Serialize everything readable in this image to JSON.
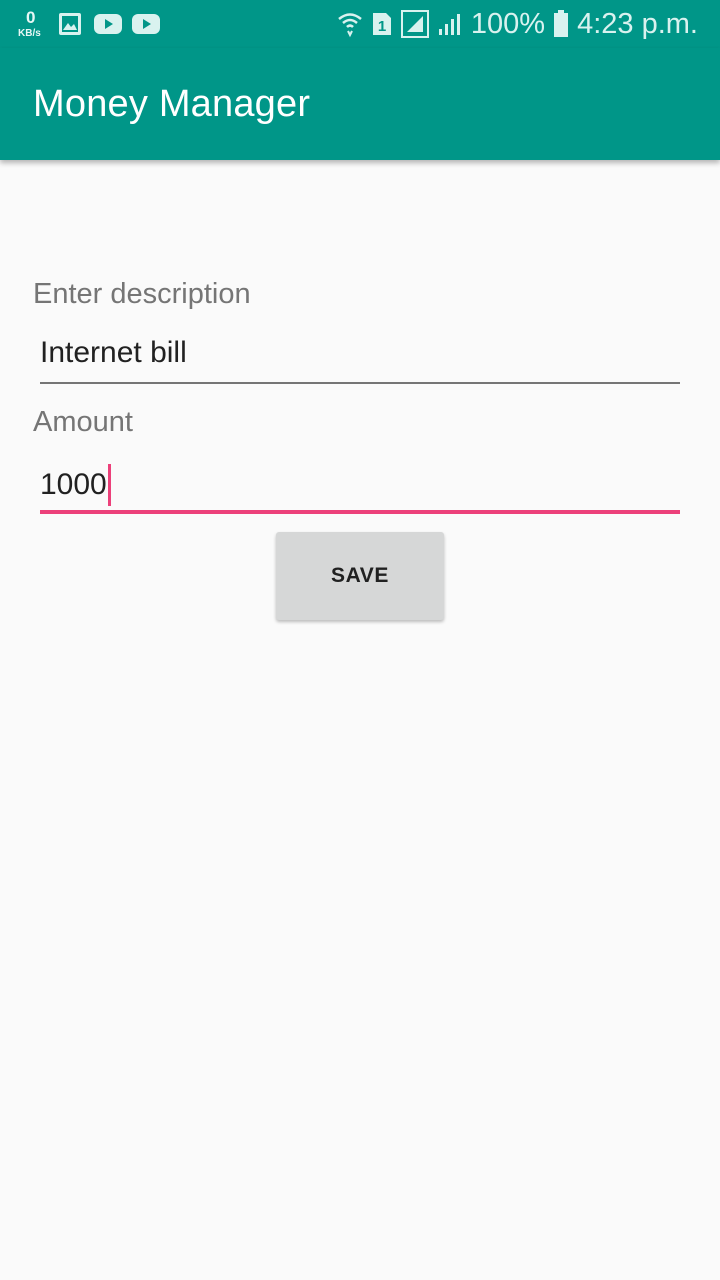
{
  "status_bar": {
    "data_speed_value": "0",
    "data_speed_unit": "KB/s",
    "left_icons": [
      "gallery-icon",
      "youtube-icon",
      "youtube-icon"
    ],
    "right_icons": [
      "wifi-icon",
      "sim1-icon",
      "signal-icon",
      "signal-icon",
      "battery-icon"
    ],
    "battery": "100%",
    "time": "4:23 p.m."
  },
  "app_bar": {
    "title": "Money Manager",
    "color": "#009688"
  },
  "form": {
    "description": {
      "label": "Enter description",
      "value": "Internet bill"
    },
    "amount": {
      "label": "Amount",
      "value": "1000",
      "focused": true,
      "accent_color": "#ec407a"
    },
    "save_label": "SAVE"
  }
}
